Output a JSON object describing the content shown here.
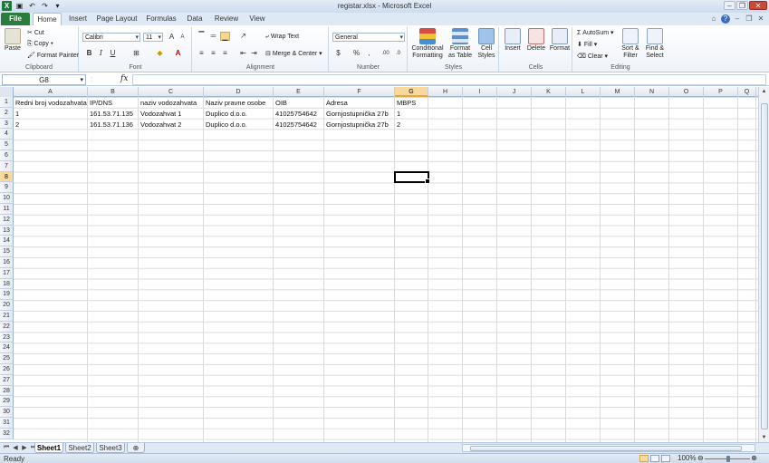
{
  "window": {
    "title": "registar.xlsx - Microsoft Excel"
  },
  "tabs": [
    {
      "label": "File"
    },
    {
      "label": "Home"
    },
    {
      "label": "Insert"
    },
    {
      "label": "Page Layout"
    },
    {
      "label": "Formulas"
    },
    {
      "label": "Data"
    },
    {
      "label": "Review"
    },
    {
      "label": "View"
    }
  ],
  "ribbon": {
    "clipboard": {
      "paste": "Paste",
      "cut": "Cut",
      "copy": "Copy",
      "format_painter": "Format Painter",
      "group": "Clipboard"
    },
    "font": {
      "name": "Calibri",
      "size": "11",
      "group": "Font"
    },
    "alignment": {
      "wrap": "Wrap Text",
      "merge": "Merge & Center",
      "group": "Alignment"
    },
    "number": {
      "format": "General",
      "percent": "%",
      "comma": ",",
      "group": "Number"
    },
    "styles": {
      "conditional": "Conditional",
      "conditional2": "Formatting",
      "format_table": "Format",
      "format_table2": "as Table",
      "cell_styles": "Cell",
      "cell_styles2": "Styles",
      "group": "Styles"
    },
    "cells": {
      "insert": "Insert",
      "delete": "Delete",
      "format": "Format",
      "group": "Cells"
    },
    "editing": {
      "autosum": "AutoSum",
      "fill": "Fill",
      "clear": "Clear",
      "sort": "Sort &",
      "sort2": "Filter",
      "find": "Find &",
      "find2": "Select",
      "group": "Editing"
    }
  },
  "formula_bar": {
    "name_box": "G8",
    "fx": "fx",
    "formula": ""
  },
  "sheet": {
    "columns": [
      "A",
      "B",
      "C",
      "D",
      "E",
      "F",
      "G",
      "H",
      "I",
      "J",
      "K",
      "L",
      "M",
      "N",
      "O",
      "P",
      "Q"
    ],
    "rows": [
      "1",
      "2",
      "3",
      "4",
      "5",
      "6",
      "7",
      "8",
      "9",
      "10",
      "11",
      "12",
      "13",
      "14",
      "15",
      "16",
      "17",
      "18",
      "19",
      "20",
      "21",
      "22",
      "23",
      "24",
      "25",
      "26",
      "27",
      "28",
      "29",
      "30",
      "31",
      "32"
    ],
    "cells": {
      "A1": "Redni broj vodozahvata",
      "B1": "IP/DNS",
      "C1": "naziv vodozahvata",
      "D1": "Naziv pravne osobe",
      "E1": "OIB",
      "F1": "Adresa",
      "G1": "MBPS",
      "A2": "1",
      "B2": "161.53.71.135",
      "C2": "Vodozahvat 1",
      "D2": "Duplico d.o.o.",
      "E2": "41025754642",
      "F2": "Gornjostupnička 27b",
      "G2": "1",
      "A3": "2",
      "B3": "161.53.71.136",
      "C3": "Vodozahvat 2",
      "D3": "Duplico d.o.o.",
      "E3": "41025754642",
      "F3": "Gornjostupnička 27b",
      "G3": "2"
    },
    "selected": "G8"
  },
  "sheet_tabs": [
    {
      "label": "Sheet1"
    },
    {
      "label": "Sheet2"
    },
    {
      "label": "Sheet3"
    }
  ],
  "status": {
    "text": "Ready",
    "zoom": "100%"
  }
}
